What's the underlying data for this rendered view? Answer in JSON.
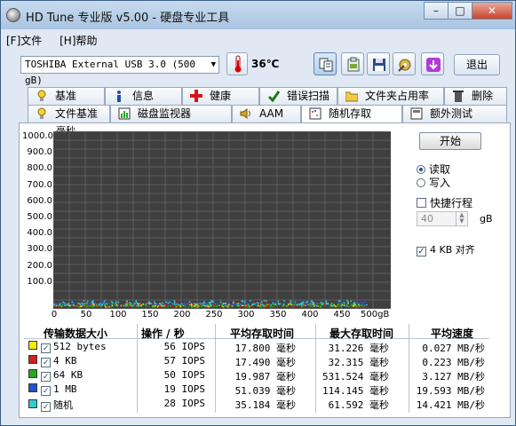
{
  "window": {
    "title": "HD Tune 专业版 v5.00 - 硬盘专业工具"
  },
  "menu": {
    "file": "[F]文件",
    "help": "[H]帮助"
  },
  "drive": {
    "selected": "TOSHIBA External USB 3.0 (500 gB)"
  },
  "temperature": "36℃",
  "exit_label": "退出",
  "tabs_row1": [
    {
      "label": "基准",
      "icon": "benchmark-icon"
    },
    {
      "label": "信息",
      "icon": "info-icon"
    },
    {
      "label": "健康",
      "icon": "health-cross-icon"
    },
    {
      "label": "错误扫描",
      "icon": "error-scan-icon"
    },
    {
      "label": "文件夹占用率",
      "icon": "folder-icon"
    },
    {
      "label": "删除",
      "icon": "trash-icon"
    }
  ],
  "tabs_row2": [
    {
      "label": "文件基准",
      "icon": "file-benchmark-icon"
    },
    {
      "label": "磁盘监视器",
      "icon": "disk-monitor-icon"
    },
    {
      "label": "AAM",
      "icon": "speaker-icon"
    },
    {
      "label": "随机存取",
      "icon": "random-access-icon",
      "active": true
    },
    {
      "label": "额外测试",
      "icon": "extra-tests-icon"
    }
  ],
  "controls": {
    "start": "开始",
    "read": "读取",
    "write": "写入",
    "quick_scan": "快捷行程",
    "quick_value": "40",
    "quick_unit": "gB",
    "align": "4 KB 对齐"
  },
  "chart_data": {
    "type": "scatter",
    "unit_label": "毫秒",
    "y_ticks": [
      "1000.0",
      "900.0",
      "800.0",
      "700.0",
      "600.0",
      "500.0",
      "400.0",
      "300.0",
      "200.0",
      "100.0"
    ],
    "x_ticks": [
      "0",
      "50",
      "100",
      "150",
      "200",
      "250",
      "300",
      "350",
      "400",
      "450",
      "500gB"
    ],
    "xlim": [
      0,
      500
    ],
    "ylim": [
      0,
      1000
    ],
    "grid": true,
    "series": [
      {
        "name": "512 bytes",
        "color": "#e6e600",
        "approx_range_ms": [
          10,
          30
        ]
      },
      {
        "name": "4 KB",
        "color": "#cc2222",
        "approx_range_ms": [
          10,
          35
        ]
      },
      {
        "name": "64 KB",
        "color": "#22aa22",
        "approx_range_ms": [
          10,
          30
        ]
      },
      {
        "name": "1 MB",
        "color": "#2255cc",
        "approx_range_ms": [
          20,
          40
        ]
      },
      {
        "name": "随机",
        "color": "#33cccc",
        "approx_range_ms": [
          15,
          45
        ]
      }
    ]
  },
  "table": {
    "headers": [
      "传输数据大小",
      "操作 / 秒",
      "平均存取时间",
      "最大存取时间",
      "平均速度"
    ],
    "rows": [
      {
        "label": "512 bytes",
        "color": "#f0f000",
        "ops": "56 IOPS",
        "avg": "17.800 毫秒",
        "max": "31.226 毫秒",
        "speed": "0.027 MB/秒"
      },
      {
        "label": "4 KB",
        "color": "#cc2222",
        "ops": "57 IOPS",
        "avg": "17.490 毫秒",
        "max": "32.315 毫秒",
        "speed": "0.223 MB/秒"
      },
      {
        "label": "64 KB",
        "color": "#22aa22",
        "ops": "50 IOPS",
        "avg": "19.987 毫秒",
        "max": "531.524 毫秒",
        "speed": "3.127 MB/秒"
      },
      {
        "label": "1 MB",
        "color": "#2255cc",
        "ops": "19 IOPS",
        "avg": "51.039 毫秒",
        "max": "114.145 毫秒",
        "speed": "19.593 MB/秒"
      },
      {
        "label": "随机",
        "color": "#33cccc",
        "ops": "28 IOPS",
        "avg": "35.184 毫秒",
        "max": "61.592 毫秒",
        "speed": "14.421 MB/秒"
      }
    ]
  }
}
